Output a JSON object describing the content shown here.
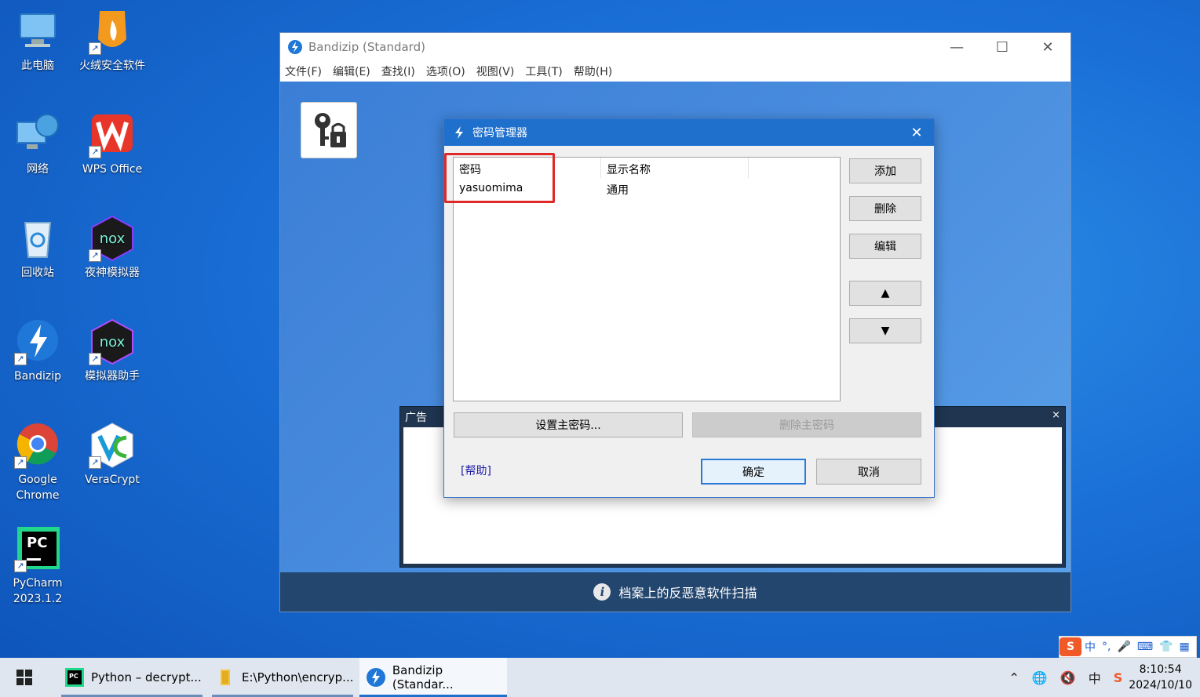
{
  "desktop": {
    "icons": [
      {
        "label": "此电脑"
      },
      {
        "label": "火绒安全软件"
      },
      {
        "label": "网络"
      },
      {
        "label": "WPS Office"
      },
      {
        "label": "回收站"
      },
      {
        "label": "夜神模拟器"
      },
      {
        "label": "Bandizip"
      },
      {
        "label": "模拟器助手"
      },
      {
        "label": "Google Chrome"
      },
      {
        "label": "VeraCrypt"
      },
      {
        "label": "PyCharm 2023.1.2"
      }
    ]
  },
  "window": {
    "title": "Bandizip (Standard)",
    "menu": [
      "文件(F)",
      "编辑(E)",
      "查找(I)",
      "选项(O)",
      "视图(V)",
      "工具(T)",
      "帮助(H)"
    ],
    "ad_label": "广告",
    "ad_close": "×",
    "status_text": "档案上的反恶意软件扫描"
  },
  "dialog": {
    "title": "密码管理器",
    "columns": [
      "密码",
      "显示名称"
    ],
    "rows": [
      {
        "password": "yasuomima",
        "display_name": "通用"
      }
    ],
    "buttons": {
      "add": "添加",
      "delete": "删除",
      "edit": "编辑",
      "up": "▲",
      "down": "▼",
      "set_master": "设置主密码...",
      "remove_master": "删除主密码",
      "ok": "确定",
      "cancel": "取消"
    },
    "help": "[帮助]"
  },
  "taskbar": {
    "items": [
      {
        "label": "Python – decrypt..."
      },
      {
        "label": "E:\\Python\\encryp..."
      },
      {
        "label": "Bandizip (Standar..."
      }
    ],
    "ime_indicator": "中",
    "clock_time": "8:10:54",
    "clock_date": "2024/10/10"
  },
  "ime_bar": {
    "lang": "中",
    "punct": "°,"
  },
  "colors": {
    "dialog_title_bg": "#1f6fcd",
    "highlight": "#e02828",
    "status_bar": "#23466f"
  }
}
